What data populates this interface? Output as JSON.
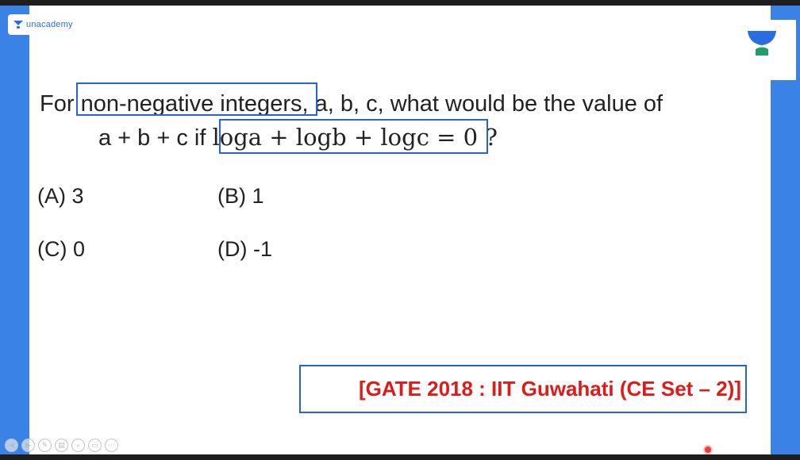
{
  "brand": {
    "name": "unacademy",
    "icon": "unacademy-logo-icon"
  },
  "question": {
    "prefix": "For ",
    "highlight": "non-negative integers",
    "suffix": ", a, b, c, what would be the value of",
    "line2_text": "a + b + c  if ",
    "equation": "loga + logb + logc = 0",
    "question_mark": " ?"
  },
  "options": [
    {
      "label": "(A) 3"
    },
    {
      "label": "(B) 1"
    },
    {
      "label": "(C) 0"
    },
    {
      "label": "(D) -1"
    }
  ],
  "source": "[GATE 2018 : IIT Guwahati (CE Set – 2)]",
  "player_controls": [
    "prev-icon",
    "next-icon",
    "pen-icon",
    "print-icon",
    "zoom-icon",
    "slides-icon",
    "more-icon"
  ],
  "colors": {
    "accent_blue": "#3b82e6",
    "box_blue": "#2563d9",
    "source_red": "#e01919"
  }
}
